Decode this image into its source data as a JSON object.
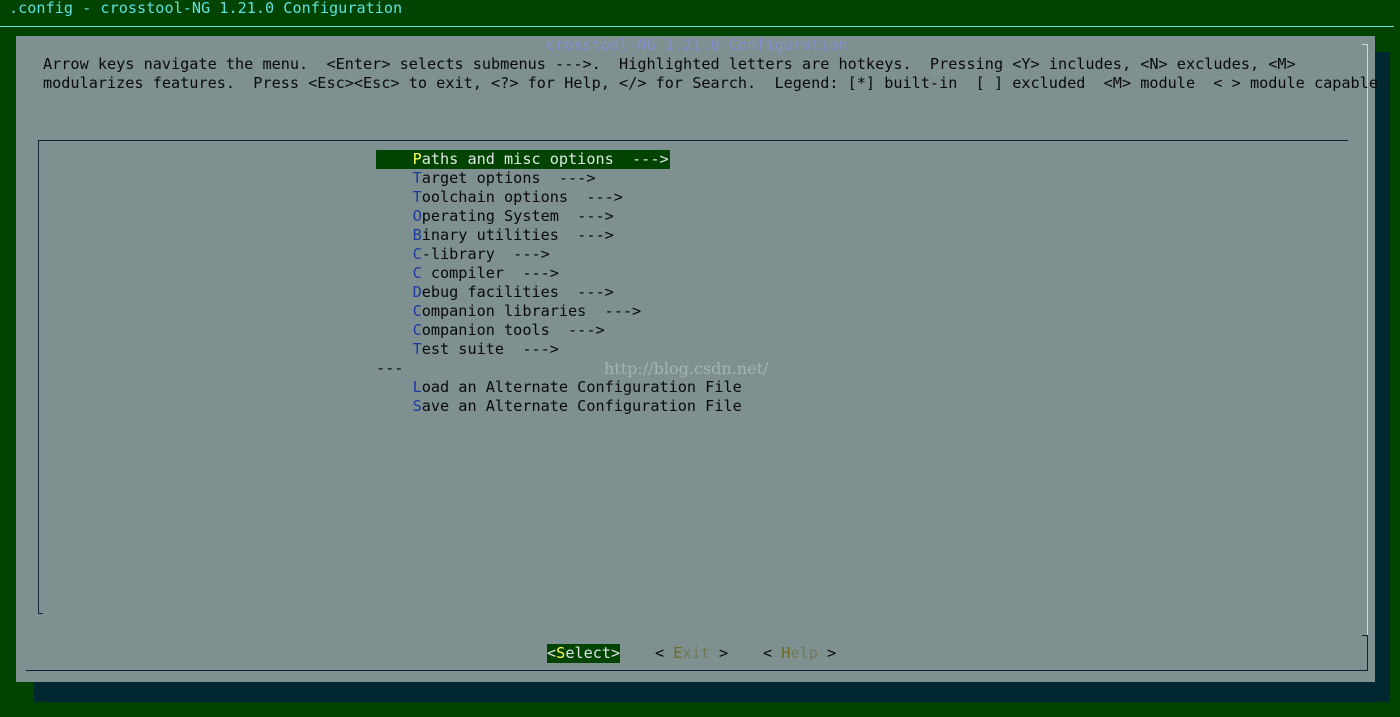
{
  "window": {
    "title": ".config - crosstool-NG 1.21.0 Configuration"
  },
  "dialog": {
    "title": "crosstool-NG 1.21.0 Configuration",
    "help_line1": "Arrow keys navigate the menu.  <Enter> selects submenus --->.  Highlighted letters are hotkeys.  Pressing <Y> includes, <N> excludes, <M>",
    "help_line2": "modularizes features.  Press <Esc><Esc> to exit, <?> for Help, </> for Search.  Legend: [*] built-in  [ ] excluded  <M> module  < > module capable"
  },
  "menu": {
    "items": [
      {
        "prefix": "    ",
        "hotkey": "P",
        "rest": "aths and misc options  --->",
        "selected": true
      },
      {
        "prefix": "    ",
        "hotkey": "T",
        "rest": "arget options  --->",
        "selected": false
      },
      {
        "prefix": "    ",
        "hotkey": "T",
        "rest": "oolchain options  --->",
        "selected": false
      },
      {
        "prefix": "    ",
        "hotkey": "O",
        "rest": "perating System  --->",
        "selected": false
      },
      {
        "prefix": "    ",
        "hotkey": "B",
        "rest": "inary utilities  --->",
        "selected": false
      },
      {
        "prefix": "    ",
        "hotkey": "C",
        "rest": "-library  --->",
        "selected": false
      },
      {
        "prefix": "    ",
        "hotkey": "C",
        "rest": " compiler  --->",
        "selected": false
      },
      {
        "prefix": "    ",
        "hotkey": "D",
        "rest": "ebug facilities  --->",
        "selected": false
      },
      {
        "prefix": "    ",
        "hotkey": "C",
        "rest": "ompanion libraries  --->",
        "selected": false
      },
      {
        "prefix": "    ",
        "hotkey": "C",
        "rest": "ompanion tools  --->",
        "selected": false
      },
      {
        "prefix": "    ",
        "hotkey": "T",
        "rest": "est suite  --->",
        "selected": false
      }
    ],
    "separator": "---",
    "file_items": [
      {
        "prefix": "    ",
        "hotkey": "L",
        "rest": "oad an Alternate Configuration File"
      },
      {
        "prefix": "    ",
        "hotkey": "S",
        "rest": "ave an Alternate Configuration File"
      }
    ]
  },
  "watermark": "http://blog.csdn.net/",
  "buttons": {
    "select": {
      "open": "<",
      "hotkey": "S",
      "rest": "elect",
      "close": ">"
    },
    "exit": {
      "open": "< ",
      "hotkey": "E",
      "rest": "xit",
      "close": " >"
    },
    "help": {
      "open": "< ",
      "hotkey": "H",
      "rest": "elp",
      "close": " >"
    }
  },
  "colors": {
    "terminal_bg": "#004400",
    "dialog_bg": "#7f9090",
    "selection_bg": "#004400",
    "hotkey_selected": "#ffff55",
    "title_text": "#5fe0e0"
  }
}
